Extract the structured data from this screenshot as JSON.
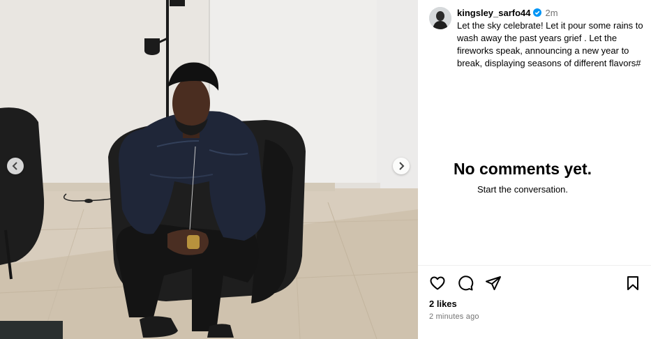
{
  "post": {
    "username": "kingsley_sarfo44",
    "time_ago": "2m",
    "caption": "Let the sky celebrate! Let it pour some rains to wash away the past years grief . Let the fireworks speak, announcing a new year to break, displaying seasons of different flavors#",
    "likes": "2 likes",
    "posted": "2 minutes ago"
  },
  "comments": {
    "empty_title": "No comments yet.",
    "empty_subtitle": "Start the conversation."
  },
  "icons": {
    "like": "heart-icon",
    "comment": "comment-icon",
    "share": "share-icon",
    "save": "bookmark-icon",
    "prev": "chevron-left-icon",
    "next": "chevron-right-icon",
    "verified": "verified-badge-icon"
  },
  "colors": {
    "verified": "#0095f6",
    "secondary_text": "#737373",
    "jacket": "#1f2638",
    "chair": "#1c1c1c"
  }
}
